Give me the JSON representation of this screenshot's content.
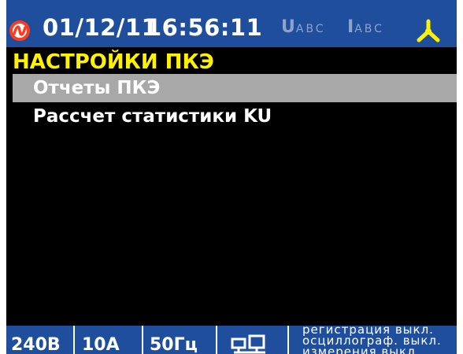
{
  "header": {
    "logo_icon": "brand-logo-icon",
    "date": "01/12/11",
    "time": "16:56:11",
    "voltage_indicator": {
      "main": "U",
      "sub": "ABC"
    },
    "current_indicator": {
      "main": "I",
      "sub": "ABC"
    },
    "phase_icon": "three-phase-star-icon",
    "colors": {
      "bar": "#1f4f9c",
      "indicator_dim": "#8ea2cd",
      "phase_icon": "#fff200",
      "logo": "#ff3b1f"
    }
  },
  "menu": {
    "title": "НАСТРОЙКИ ПКЭ",
    "items": [
      {
        "label": "Отчеты ПКЭ",
        "selected": true
      },
      {
        "label": "Рассчет статистики KU",
        "selected": false
      }
    ],
    "colors": {
      "title": "#fff200",
      "selection": "#a8a8a8"
    }
  },
  "footer": {
    "voltage": "240В",
    "current": "10А",
    "frequency": "50Гц",
    "network_icon": "network-computers-icon",
    "status_lines": [
      "регистрация выкл.",
      "осциллограф. выкл.",
      "измерения выкл."
    ]
  }
}
